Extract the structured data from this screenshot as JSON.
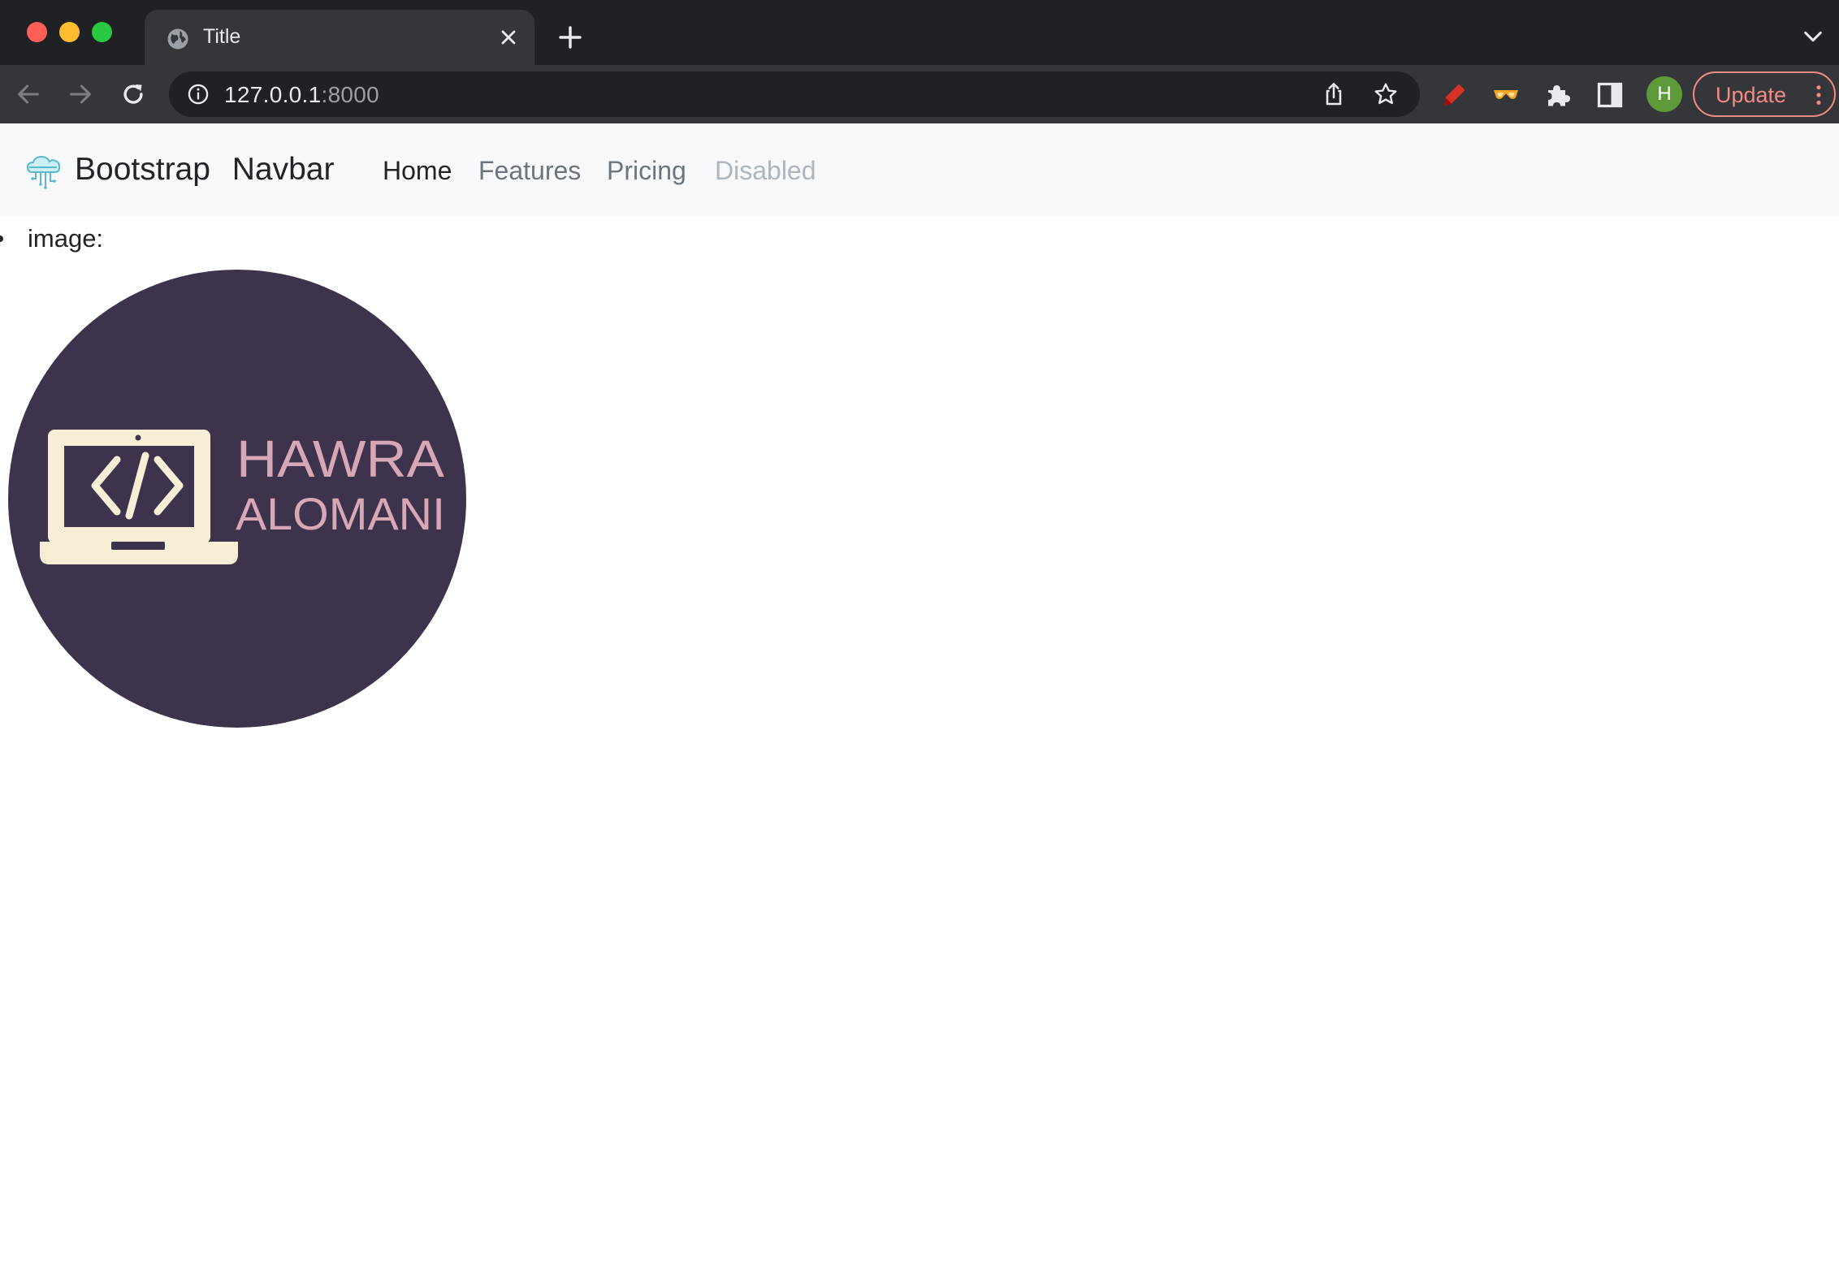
{
  "browser": {
    "tab": {
      "title": "Title",
      "icon": "globe-icon"
    },
    "address_bar": {
      "host": "127.0.0.1",
      "port": ":8000"
    },
    "profile_initial": "H",
    "update_label": "Update",
    "colors": {
      "chrome_dark": "#202124",
      "toolbar": "#35363a",
      "update_accent": "#f28b82",
      "avatar": "#5f9a3a"
    }
  },
  "navbar": {
    "brand": "Bootstrap Navbar",
    "brand_icon": "cloud-icon",
    "links": [
      {
        "label": "Home",
        "state": "active"
      },
      {
        "label": "Features",
        "state": "normal"
      },
      {
        "label": "Pricing",
        "state": "normal"
      },
      {
        "label": "Disabled",
        "state": "disabled"
      }
    ],
    "background": "#f8f9fa"
  },
  "content": {
    "list_item_label": "image:",
    "logo": {
      "line1": "HAWRA",
      "line2": "ALOMANI",
      "code_glyph": "</>",
      "circle_color": "#3d334d",
      "laptop_color": "#f7eed6",
      "text_color": "#d8a7b6"
    }
  }
}
